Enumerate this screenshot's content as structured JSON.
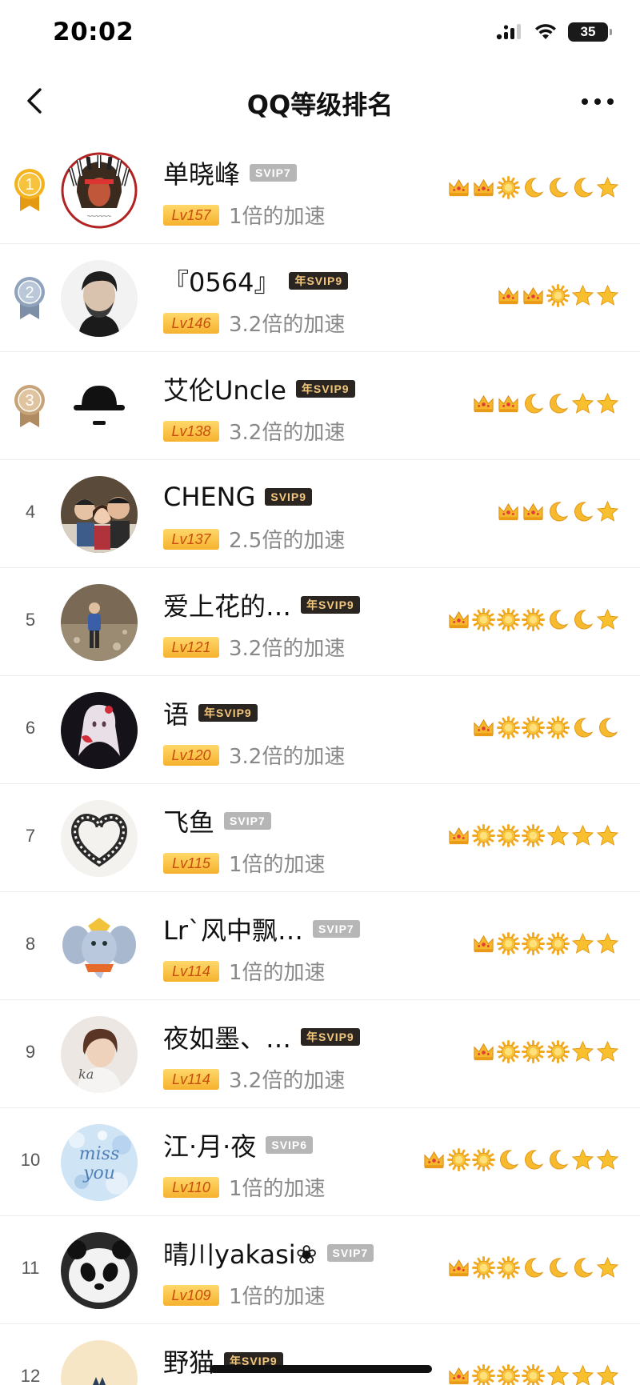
{
  "status_bar": {
    "time": "20:02",
    "battery": "35"
  },
  "nav": {
    "title": "QQ等级排名"
  },
  "rows": [
    {
      "rank": "1",
      "medal": "gold",
      "name": "单晓峰",
      "vip": "SVIP7",
      "vip_style": "gray",
      "level": "Lv157",
      "speed": "1倍的加速",
      "badges": [
        "crown",
        "crown",
        "sun",
        "moon",
        "moon",
        "moon",
        "star"
      ],
      "avatar": "indian-chief-logo"
    },
    {
      "rank": "2",
      "medal": "silver",
      "name": "『0564』",
      "vip": "年SVIP9",
      "vip_style": "dark",
      "level": "Lv146",
      "speed": "3.2倍的加速",
      "badges": [
        "crown",
        "crown",
        "sun",
        "star",
        "star"
      ],
      "avatar": "man-portrait"
    },
    {
      "rank": "3",
      "medal": "bronze",
      "name": "艾伦Uncle",
      "vip": "年SVIP9",
      "vip_style": "dark",
      "level": "Lv138",
      "speed": "3.2倍的加速",
      "badges": [
        "crown",
        "crown",
        "moon",
        "moon",
        "star",
        "star"
      ],
      "avatar": "bowler-hat"
    },
    {
      "rank": "4",
      "medal": "",
      "name": "CHENG",
      "vip": "SVIP9",
      "vip_style": "dark",
      "level": "Lv137",
      "speed": "2.5倍的加速",
      "badges": [
        "crown",
        "crown",
        "moon",
        "moon",
        "star"
      ],
      "avatar": "family-photo"
    },
    {
      "rank": "5",
      "medal": "",
      "name": "爱上花的…",
      "vip": "年SVIP9",
      "vip_style": "dark",
      "level": "Lv121",
      "speed": "3.2倍的加速",
      "badges": [
        "crown",
        "sun",
        "sun",
        "sun",
        "moon",
        "moon",
        "star"
      ],
      "avatar": "person-outdoors"
    },
    {
      "rank": "6",
      "medal": "",
      "name": "语",
      "vip": "年SVIP9",
      "vip_style": "dark",
      "level": "Lv120",
      "speed": "3.2倍的加速",
      "badges": [
        "crown",
        "sun",
        "sun",
        "sun",
        "moon",
        "moon"
      ],
      "avatar": "anime-girl"
    },
    {
      "rank": "7",
      "medal": "",
      "name": "飞鱼",
      "vip": "SVIP7",
      "vip_style": "gray",
      "level": "Lv115",
      "speed": "1倍的加速",
      "badges": [
        "crown",
        "sun",
        "sun",
        "sun",
        "star",
        "star",
        "star"
      ],
      "avatar": "film-heart"
    },
    {
      "rank": "8",
      "medal": "",
      "name": "Lr`风中飘…",
      "vip": "SVIP7",
      "vip_style": "gray",
      "level": "Lv114",
      "speed": "1倍的加速",
      "badges": [
        "crown",
        "sun",
        "sun",
        "sun",
        "star",
        "star"
      ],
      "avatar": "dumbo-elephant"
    },
    {
      "rank": "9",
      "medal": "",
      "name": "夜如墨、…",
      "vip": "年SVIP9",
      "vip_style": "dark",
      "level": "Lv114",
      "speed": "3.2倍的加速",
      "badges": [
        "crown",
        "sun",
        "sun",
        "sun",
        "star",
        "star"
      ],
      "avatar": "boy-portrait"
    },
    {
      "rank": "10",
      "medal": "",
      "name": "江·月·夜",
      "vip": "SVIP6",
      "vip_style": "gray",
      "level": "Lv110",
      "speed": "1倍的加速",
      "badges": [
        "crown",
        "sun",
        "sun",
        "moon",
        "moon",
        "moon",
        "star",
        "star"
      ],
      "avatar": "miss-you-text"
    },
    {
      "rank": "11",
      "medal": "",
      "name": "晴川yakasi❀",
      "vip": "SVIP7",
      "vip_style": "gray",
      "level": "Lv109",
      "speed": "1倍的加速",
      "badges": [
        "crown",
        "sun",
        "sun",
        "moon",
        "moon",
        "moon",
        "star"
      ],
      "avatar": "panda"
    },
    {
      "rank": "12",
      "medal": "",
      "name": "野猫",
      "vip": "年SVIP9",
      "vip_style": "dark",
      "level": "",
      "speed": "",
      "badges": [
        "crown",
        "sun",
        "sun",
        "sun",
        "star",
        "star",
        "star"
      ],
      "avatar": "cat"
    }
  ]
}
